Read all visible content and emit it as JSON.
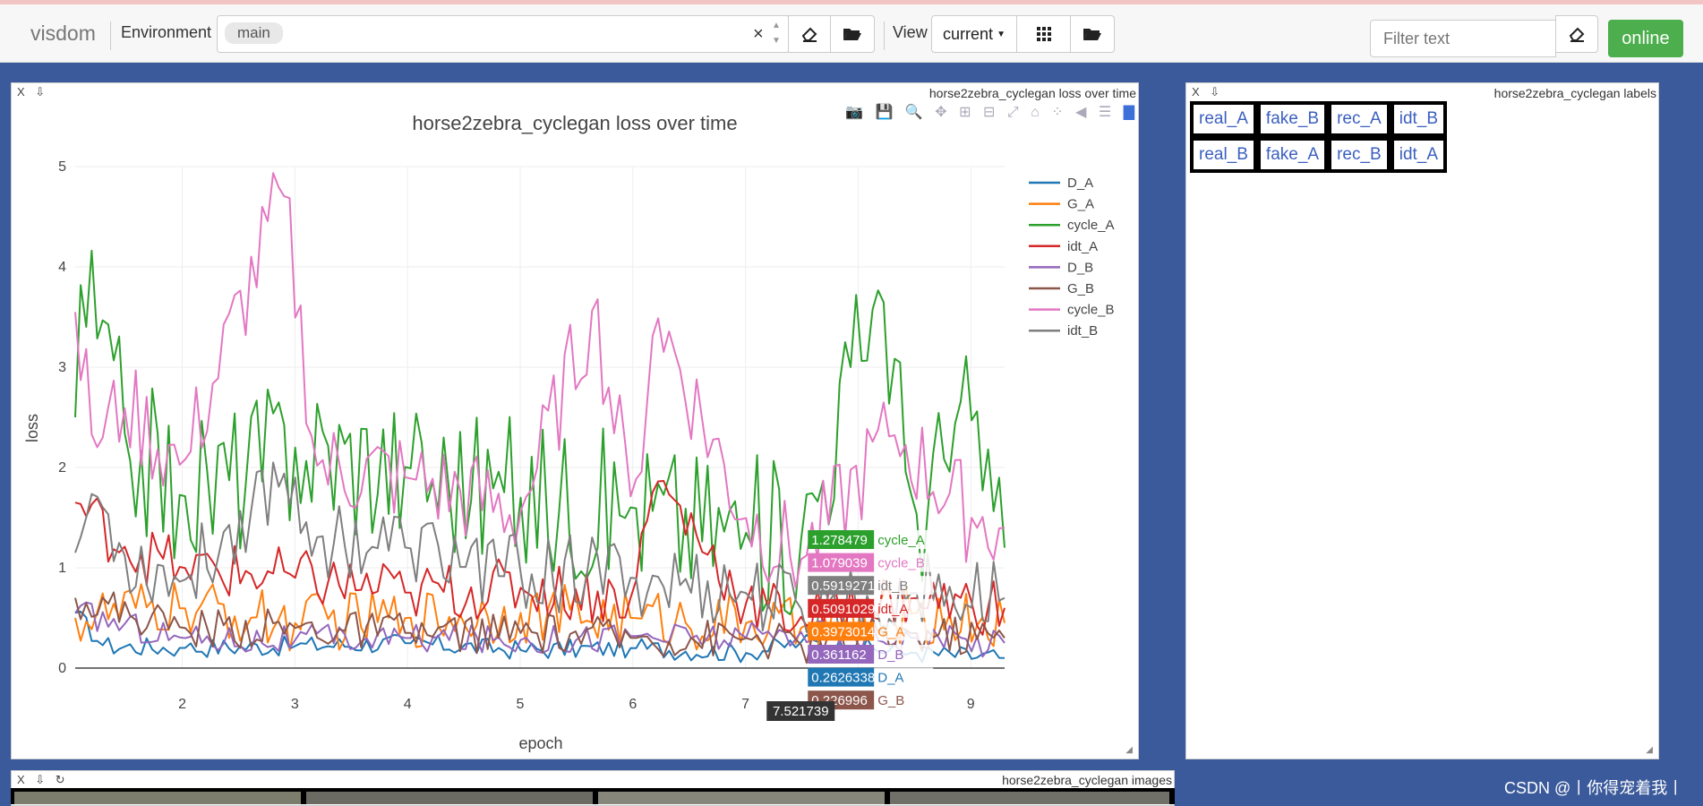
{
  "topbar": {
    "logo": "visdom",
    "env_label": "Environment",
    "env_chip": "main",
    "clear_glyph": "×",
    "view_label": "View",
    "view_select": "current",
    "filter_placeholder": "Filter text",
    "online_label": "online"
  },
  "loss_pane": {
    "pane_title": "horse2zebra_cyclegan loss over time",
    "controls": "X ⇩"
  },
  "labels_pane": {
    "pane_title": "horse2zebra_cyclegan labels",
    "controls": "X ⇩",
    "rows": [
      [
        "real_A",
        "fake_B",
        "rec_A",
        "idt_B"
      ],
      [
        "real_B",
        "fake_A",
        "rec_B",
        "idt_A"
      ]
    ]
  },
  "images_pane": {
    "pane_title": "horse2zebra_cyclegan images",
    "controls": "X ⇩ ↻"
  },
  "watermark": "CSDN @丨你得宠着我丨",
  "chart_data": {
    "type": "line",
    "title": "horse2zebra_cyclegan loss over time",
    "xlabel": "epoch",
    "ylabel": "loss",
    "xlim": [
      1.05,
      9.3
    ],
    "ylim": [
      0,
      5
    ],
    "xticks": [
      2,
      3,
      4,
      5,
      6,
      7,
      8,
      9
    ],
    "yticks": [
      0,
      1,
      2,
      3,
      4,
      5
    ],
    "grid": true,
    "legend_position": "right",
    "series": [
      {
        "name": "D_A",
        "color": "#1f77b4",
        "anchors": [
          [
            1.05,
            0.55
          ],
          [
            1.3,
            0.22
          ],
          [
            2,
            0.2
          ],
          [
            3,
            0.22
          ],
          [
            4,
            0.25
          ],
          [
            5,
            0.18
          ],
          [
            6,
            0.2
          ],
          [
            7,
            0.15
          ],
          [
            7.5,
            0.26
          ],
          [
            8.5,
            0.15
          ],
          [
            9.3,
            0.1
          ]
        ],
        "amp": 0.1
      },
      {
        "name": "G_A",
        "color": "#ff7f0e",
        "anchors": [
          [
            1.05,
            0.5
          ],
          [
            2,
            0.6
          ],
          [
            3,
            0.45
          ],
          [
            4,
            0.5
          ],
          [
            5,
            0.55
          ],
          [
            6,
            0.5
          ],
          [
            7,
            0.45
          ],
          [
            7.5,
            0.4
          ],
          [
            8.5,
            0.55
          ],
          [
            9.3,
            0.45
          ]
        ],
        "amp": 0.3
      },
      {
        "name": "cycle_A",
        "color": "#2ca02c",
        "anchors": [
          [
            1.05,
            2.5
          ],
          [
            1.1,
            3.85
          ],
          [
            1.5,
            2.3
          ],
          [
            2,
            1.7
          ],
          [
            3,
            2.2
          ],
          [
            4,
            2.0
          ],
          [
            5,
            1.7
          ],
          [
            6,
            1.6
          ],
          [
            7,
            1.35
          ],
          [
            7.5,
            1.28
          ],
          [
            8.2,
            3.85
          ],
          [
            8.5,
            1.5
          ],
          [
            9,
            2.5
          ],
          [
            9.3,
            1.2
          ]
        ],
        "amp": 0.8
      },
      {
        "name": "idt_A",
        "color": "#d62728",
        "anchors": [
          [
            1.05,
            1.65
          ],
          [
            1.5,
            1.2
          ],
          [
            2,
            1.0
          ],
          [
            3,
            0.9
          ],
          [
            4,
            0.75
          ],
          [
            5,
            0.8
          ],
          [
            6,
            0.7
          ],
          [
            6.2,
            1.9
          ],
          [
            7,
            0.65
          ],
          [
            7.5,
            0.51
          ],
          [
            8.5,
            0.7
          ],
          [
            9.3,
            0.6
          ]
        ],
        "amp": 0.3
      },
      {
        "name": "D_B",
        "color": "#9467bd",
        "anchors": [
          [
            1.05,
            0.55
          ],
          [
            2,
            0.3
          ],
          [
            3,
            0.28
          ],
          [
            4,
            0.3
          ],
          [
            5,
            0.28
          ],
          [
            6,
            0.32
          ],
          [
            7,
            0.3
          ],
          [
            7.5,
            0.36
          ],
          [
            8.5,
            0.3
          ],
          [
            9.3,
            0.25
          ]
        ],
        "amp": 0.15
      },
      {
        "name": "G_B",
        "color": "#8c564b",
        "anchors": [
          [
            1.05,
            0.7
          ],
          [
            2,
            0.4
          ],
          [
            3,
            0.4
          ],
          [
            4,
            0.35
          ],
          [
            5,
            0.35
          ],
          [
            6,
            0.3
          ],
          [
            7,
            0.3
          ],
          [
            7.5,
            0.23
          ],
          [
            8.5,
            0.35
          ],
          [
            9.3,
            0.3
          ]
        ],
        "amp": 0.2
      },
      {
        "name": "cycle_B",
        "color": "#e377c2",
        "anchors": [
          [
            1.05,
            3.55
          ],
          [
            1.2,
            2.3
          ],
          [
            1.5,
            2.6
          ],
          [
            2,
            2.0
          ],
          [
            2.9,
            4.75
          ],
          [
            3.2,
            2.0
          ],
          [
            4,
            1.9
          ],
          [
            5,
            1.55
          ],
          [
            5.65,
            3.6
          ],
          [
            6,
            1.6
          ],
          [
            6.2,
            3.55
          ],
          [
            7,
            1.5
          ],
          [
            7.5,
            1.08
          ],
          [
            8.3,
            2.35
          ],
          [
            9,
            1.5
          ],
          [
            9.3,
            1.4
          ]
        ],
        "amp": 0.5
      },
      {
        "name": "idt_B",
        "color": "#7f7f7f",
        "anchors": [
          [
            1.05,
            1.15
          ],
          [
            1.2,
            1.75
          ],
          [
            1.5,
            1.1
          ],
          [
            2,
            0.85
          ],
          [
            2.9,
            1.95
          ],
          [
            3.2,
            1.3
          ],
          [
            4,
            1.2
          ],
          [
            5,
            0.95
          ],
          [
            6,
            0.9
          ],
          [
            7,
            0.75
          ],
          [
            7.5,
            0.59
          ],
          [
            8.5,
            0.75
          ],
          [
            9.3,
            0.7
          ]
        ],
        "amp": 0.4
      }
    ],
    "hover": {
      "x_label": "7.521739",
      "items": [
        {
          "value": "1.278479",
          "name": "cycle_A",
          "color": "#2ca02c"
        },
        {
          "value": "1.079039",
          "name": "cycle_B",
          "color": "#e377c2"
        },
        {
          "value": "0.5919271",
          "name": "idt_B",
          "color": "#7f7f7f"
        },
        {
          "value": "0.5091029",
          "name": "idt_A",
          "color": "#d62728"
        },
        {
          "value": "0.3973014",
          "name": "G_A",
          "color": "#ff7f0e"
        },
        {
          "value": "0.361162",
          "name": "D_B",
          "color": "#9467bd"
        },
        {
          "value": "0.2626338",
          "name": "D_A",
          "color": "#1f77b4"
        },
        {
          "value": "0.226996",
          "name": "G_B",
          "color": "#8c564b"
        }
      ]
    }
  }
}
